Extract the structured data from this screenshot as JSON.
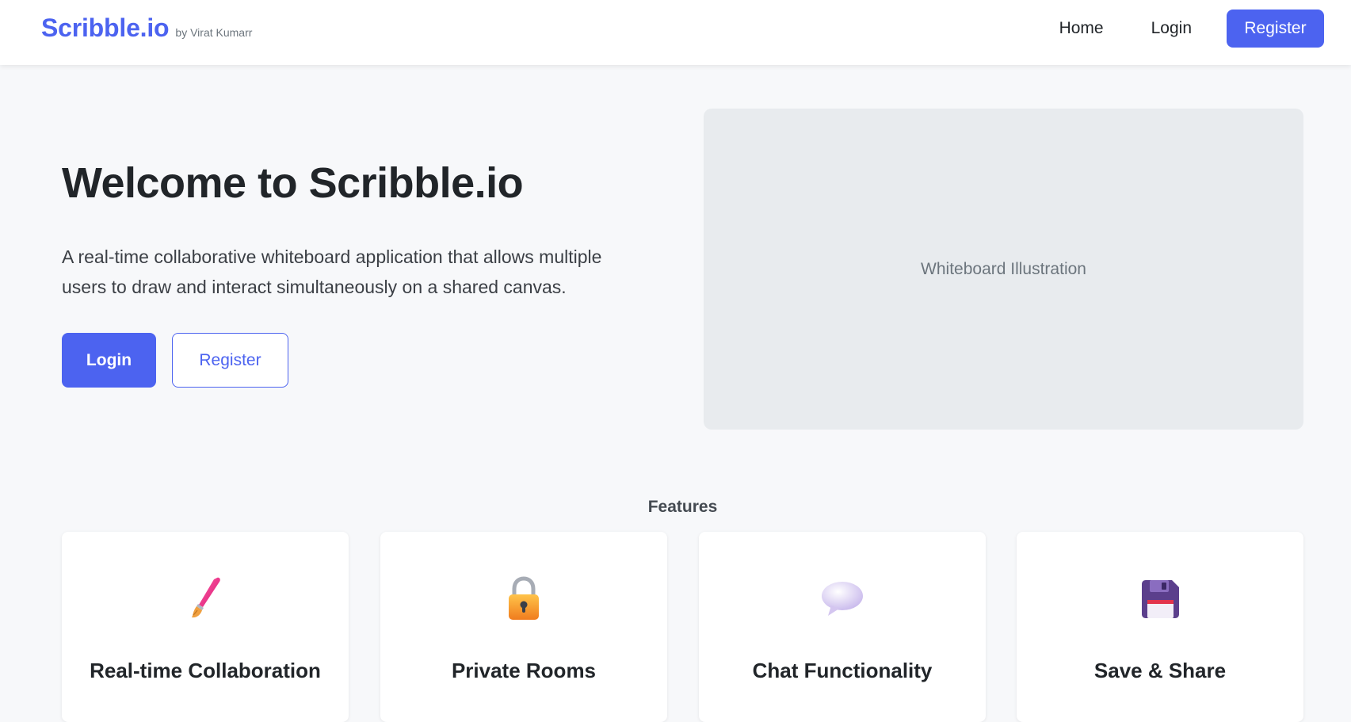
{
  "navbar": {
    "brand": "Scribble.io",
    "byline": "by Virat Kumarr",
    "links": {
      "home": "Home",
      "login": "Login",
      "register": "Register"
    }
  },
  "hero": {
    "title": "Welcome to Scribble.io",
    "description": "A real-time collaborative whiteboard application that allows multiple users to draw and interact simultaneously on a shared canvas.",
    "login_label": "Login",
    "register_label": "Register",
    "illustration_label": "Whiteboard Illustration"
  },
  "features": {
    "heading": "Features",
    "items": [
      {
        "icon": "paintbrush-icon",
        "title": "Real-time Collaboration"
      },
      {
        "icon": "lock-icon",
        "title": "Private Rooms"
      },
      {
        "icon": "speech-bubble-icon",
        "title": "Chat Functionality"
      },
      {
        "icon": "floppy-disk-icon",
        "title": "Save & Share"
      }
    ]
  },
  "colors": {
    "accent": "#4c63f0",
    "background": "#f7f8fa",
    "illustration_bg": "#e8ebee"
  }
}
